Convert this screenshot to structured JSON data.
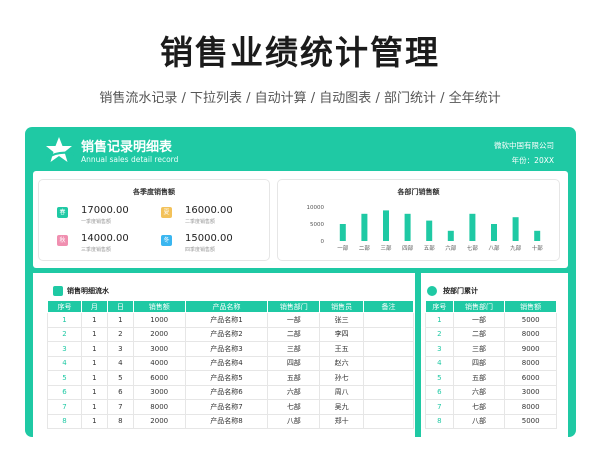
{
  "page": {
    "title": "销售业绩统计管理",
    "subtitle": "销售流水记录 / 下拉列表 / 自动计算 / 自动图表 / 部门统计 / 全年统计"
  },
  "header": {
    "title": "销售记录明细表",
    "subtitle": "Annual sales detail record",
    "company": "微软中国有限公司",
    "year": "年份：20XX"
  },
  "quarters": {
    "title": "各季度销售额",
    "items": [
      {
        "badge": "春",
        "value": "17000.00",
        "label": "一季度销售额",
        "color": "#1fc9a4"
      },
      {
        "badge": "夏",
        "value": "16000.00",
        "label": "二季度销售额",
        "color": "#f3c25a"
      },
      {
        "badge": "秋",
        "value": "14000.00",
        "label": "三季度销售额",
        "color": "#f08fb0"
      },
      {
        "badge": "冬",
        "value": "15000.00",
        "label": "四季度销售额",
        "color": "#3ab6f0"
      }
    ]
  },
  "chart_data": {
    "type": "bar",
    "title": "各部门销售额",
    "categories": [
      "一部",
      "二部",
      "三部",
      "四部",
      "五部",
      "六部",
      "七部",
      "八部",
      "九部",
      "十部"
    ],
    "values": [
      5000,
      8000,
      9000,
      8000,
      6000,
      3000,
      8000,
      5000,
      7000,
      3000
    ],
    "ylim": [
      0,
      10000
    ],
    "yticks": [
      "10000",
      "5000",
      "0"
    ],
    "color": "#1fc9a4"
  },
  "detail": {
    "title": "销售明细流水",
    "columns": [
      "序号",
      "月",
      "日",
      "销售额",
      "产品名称",
      "销售部门",
      "销售员",
      "备注"
    ],
    "rows": [
      [
        "1",
        "1",
        "1",
        "1000",
        "产品名称1",
        "一部",
        "张三",
        ""
      ],
      [
        "2",
        "1",
        "2",
        "2000",
        "产品名称2",
        "二部",
        "李四",
        ""
      ],
      [
        "3",
        "1",
        "3",
        "3000",
        "产品名称3",
        "三部",
        "王五",
        ""
      ],
      [
        "4",
        "1",
        "4",
        "4000",
        "产品名称4",
        "四部",
        "赵六",
        ""
      ],
      [
        "5",
        "1",
        "5",
        "6000",
        "产品名称5",
        "五部",
        "孙七",
        ""
      ],
      [
        "6",
        "1",
        "6",
        "3000",
        "产品名称6",
        "六部",
        "周八",
        ""
      ],
      [
        "7",
        "1",
        "7",
        "8000",
        "产品名称7",
        "七部",
        "吴九",
        ""
      ],
      [
        "8",
        "1",
        "8",
        "2000",
        "产品名称8",
        "八部",
        "郑十",
        ""
      ]
    ]
  },
  "dept": {
    "title": "按部门累计",
    "columns": [
      "序号",
      "销售部门",
      "销售额"
    ],
    "rows": [
      [
        "1",
        "一部",
        "5000"
      ],
      [
        "2",
        "二部",
        "8000"
      ],
      [
        "3",
        "三部",
        "9000"
      ],
      [
        "4",
        "四部",
        "8000"
      ],
      [
        "5",
        "五部",
        "6000"
      ],
      [
        "6",
        "六部",
        "3000"
      ],
      [
        "7",
        "七部",
        "8000"
      ],
      [
        "8",
        "八部",
        "5000"
      ]
    ]
  }
}
